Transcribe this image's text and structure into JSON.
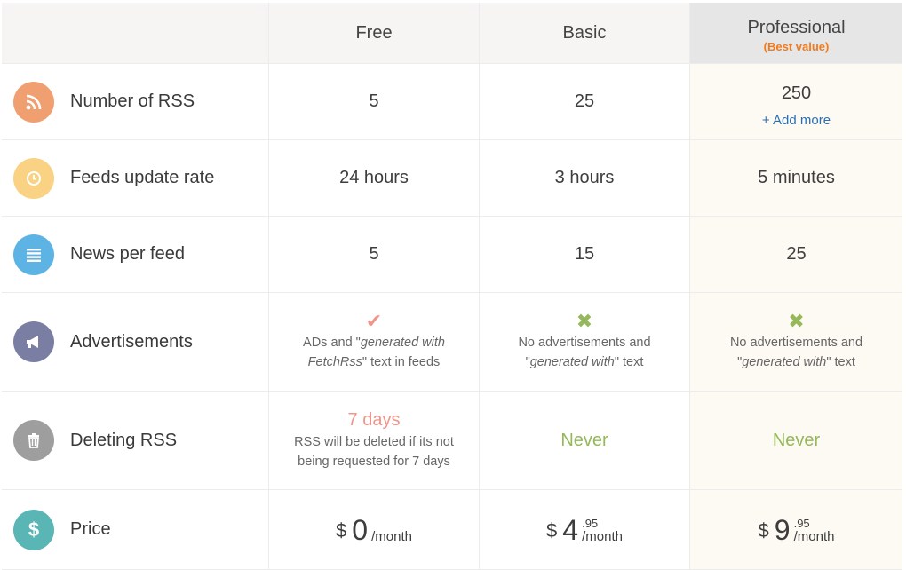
{
  "columns": {
    "free": "Free",
    "basic": "Basic",
    "professional": "Professional",
    "best_value": "(Best value)"
  },
  "rows": {
    "rss": {
      "label": "Number of RSS",
      "icon": "rss-icon",
      "color": "#f0a070",
      "free": "5",
      "basic": "25",
      "pro": "250",
      "add_more": "+ Add more"
    },
    "update": {
      "label": "Feeds update rate",
      "icon": "clock-icon",
      "color": "#fad283",
      "free": "24 hours",
      "basic": "3 hours",
      "pro": "5 minutes"
    },
    "news": {
      "label": "News per feed",
      "icon": "list-icon",
      "color": "#5db4e4",
      "free": "5",
      "basic": "15",
      "pro": "25"
    },
    "ads": {
      "label": "Advertisements",
      "icon": "megaphone-icon",
      "color": "#7a7ea3",
      "free": {
        "mark": "✔",
        "t1": "ADs and \"",
        "em1": "generated with",
        "t2": "FetchRss",
        "t3": "\" text in feeds"
      },
      "basic": {
        "mark": "✖",
        "t1": "No advertisements and",
        "t2": "\"",
        "em": "generated with",
        "t3": "\" text"
      },
      "pro": {
        "mark": "✖",
        "t1": "No advertisements and",
        "t2": "\"",
        "em": "generated with",
        "t3": "\" text"
      }
    },
    "delete": {
      "label": "Deleting RSS",
      "icon": "trash-icon",
      "color": "#9e9e9e",
      "free_days": "7 days",
      "free_desc1": "RSS will be deleted if its not",
      "free_desc2": "being requested for 7 days",
      "basic": "Never",
      "pro": "Never"
    },
    "price": {
      "label": "Price",
      "icon": "dollar-icon",
      "color": "#5ab5b5",
      "currency": "$",
      "free": {
        "amount": "0",
        "cents": "",
        "per": "/month"
      },
      "basic": {
        "amount": "4",
        "cents": ".95",
        "per": "/month"
      },
      "pro": {
        "amount": "9",
        "cents": ".95",
        "per": "/month"
      }
    }
  }
}
